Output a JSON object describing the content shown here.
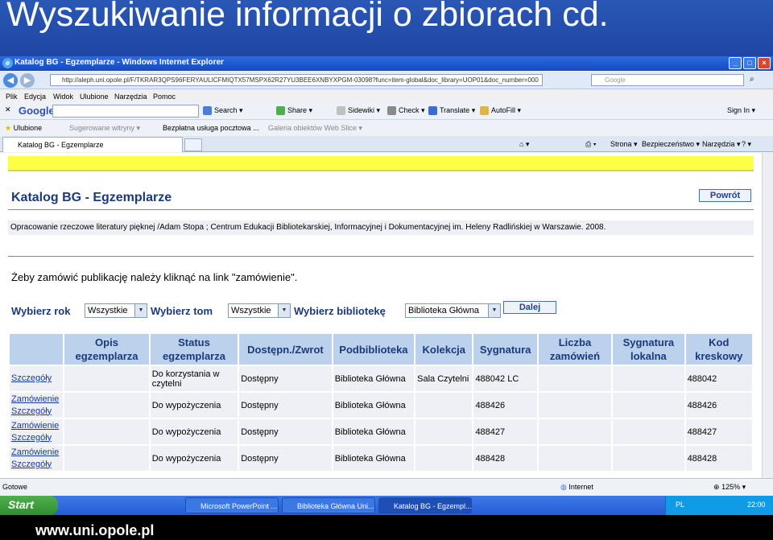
{
  "slide": {
    "title": "Wyszukiwanie informacji o zbiorach cd.",
    "footer": "www.uni.opole.pl"
  },
  "browser": {
    "window_title": "Katalog BG - Egzemplarze - Windows Internet Explorer",
    "address": "http://aleph.uni.opole.pl/F/TKRAR3QPS96FERYAULICFMIQTX57MSPX62R27YU3BEE6XNBYXPGM-03098?func=item-global&doc_library=UOP01&doc_number=000",
    "search_placeholder": "Google",
    "menu": [
      "Plik",
      "Edycja",
      "Widok",
      "Ulubione",
      "Narzędzia",
      "Pomoc"
    ],
    "google_toolbar": {
      "logo": "Google",
      "search": "Search",
      "share": "Share",
      "sidewiki": "Sidewiki",
      "check": "Check",
      "translate": "Translate",
      "autofill": "AutoFill",
      "signin": "Sign In"
    },
    "favorites": {
      "label": "Ulubione",
      "items": [
        "Sugerowane witryny",
        "Bezpłatna usługa pocztowa ...",
        "Galeria obiektów Web Slice"
      ]
    },
    "tab": "Katalog BG - Egzemplarze",
    "tab_tools": {
      "strona": "Strona",
      "bezpieczenstwo": "Bezpieczeństwo",
      "narzedzia": "Narzędzia"
    },
    "status": {
      "text": "Gotowe",
      "zone": "Internet",
      "zoom": "125%"
    }
  },
  "page": {
    "heading": "Katalog BG - Egzemplarze",
    "back_button": "Powrót",
    "record": "Opracowanie rzeczowe literatury pięknej /Adam Stopa ; Centrum Edukacji Bibliotekarskiej, Informacyjnej i Dokumentacyjnej im. Heleny Radlińskiej w Warszawie. 2008.",
    "info": "Żeby zamówić publikację należy kliknąć na link \"zamówienie\".",
    "filters": {
      "year_label": "Wybierz rok",
      "year_value": "Wszystkie",
      "volume_label": "Wybierz tom",
      "volume_value": "Wszystkie",
      "library_label": "Wybierz bibliotekę",
      "library_value": "Biblioteka Główna",
      "next_button": "Dalej"
    },
    "columns": [
      "",
      "Opis egzemplarza",
      "Status egzemplarza",
      "Dostępn./Zwrot",
      "Podbiblioteka",
      "Kolekcja",
      "Sygnatura",
      "Liczba zamówień",
      "Sygnatura lokalna",
      "Kod kreskowy"
    ],
    "rows": [
      {
        "order": "",
        "details": "Szczegóły",
        "opis": "",
        "status": "Do korzystania w czytelni",
        "dostepn": "Dostępny",
        "podbiblioteka": "Biblioteka Główna",
        "kolekcja": "Sala Czytelni",
        "sygnatura": "488042 LC",
        "liczba": "",
        "lokalna": "",
        "kod": "488042"
      },
      {
        "order": "Zamówienie",
        "details": "Szczegóły",
        "opis": "",
        "status": "Do wypożyczenia",
        "dostepn": "Dostępny",
        "podbiblioteka": "Biblioteka Główna",
        "kolekcja": "",
        "sygnatura": "488426",
        "liczba": "",
        "lokalna": "",
        "kod": "488426"
      },
      {
        "order": "Zamówienie",
        "details": "Szczegóły",
        "opis": "",
        "status": "Do wypożyczenia",
        "dostepn": "Dostępny",
        "podbiblioteka": "Biblioteka Główna",
        "kolekcja": "",
        "sygnatura": "488427",
        "liczba": "",
        "lokalna": "",
        "kod": "488427"
      },
      {
        "order": "Zamówienie",
        "details": "Szczegóły",
        "opis": "",
        "status": "Do wypożyczenia",
        "dostepn": "Dostępny",
        "podbiblioteka": "Biblioteka Główna",
        "kolekcja": "",
        "sygnatura": "488428",
        "liczba": "",
        "lokalna": "",
        "kod": "488428"
      }
    ]
  },
  "taskbar": {
    "start": "Start",
    "windows": [
      "Microsoft PowerPoint ...",
      "Biblioteka Główna Uni...",
      "Katalog BG - Egzempl..."
    ],
    "language": "PL",
    "clock": "22:00"
  }
}
